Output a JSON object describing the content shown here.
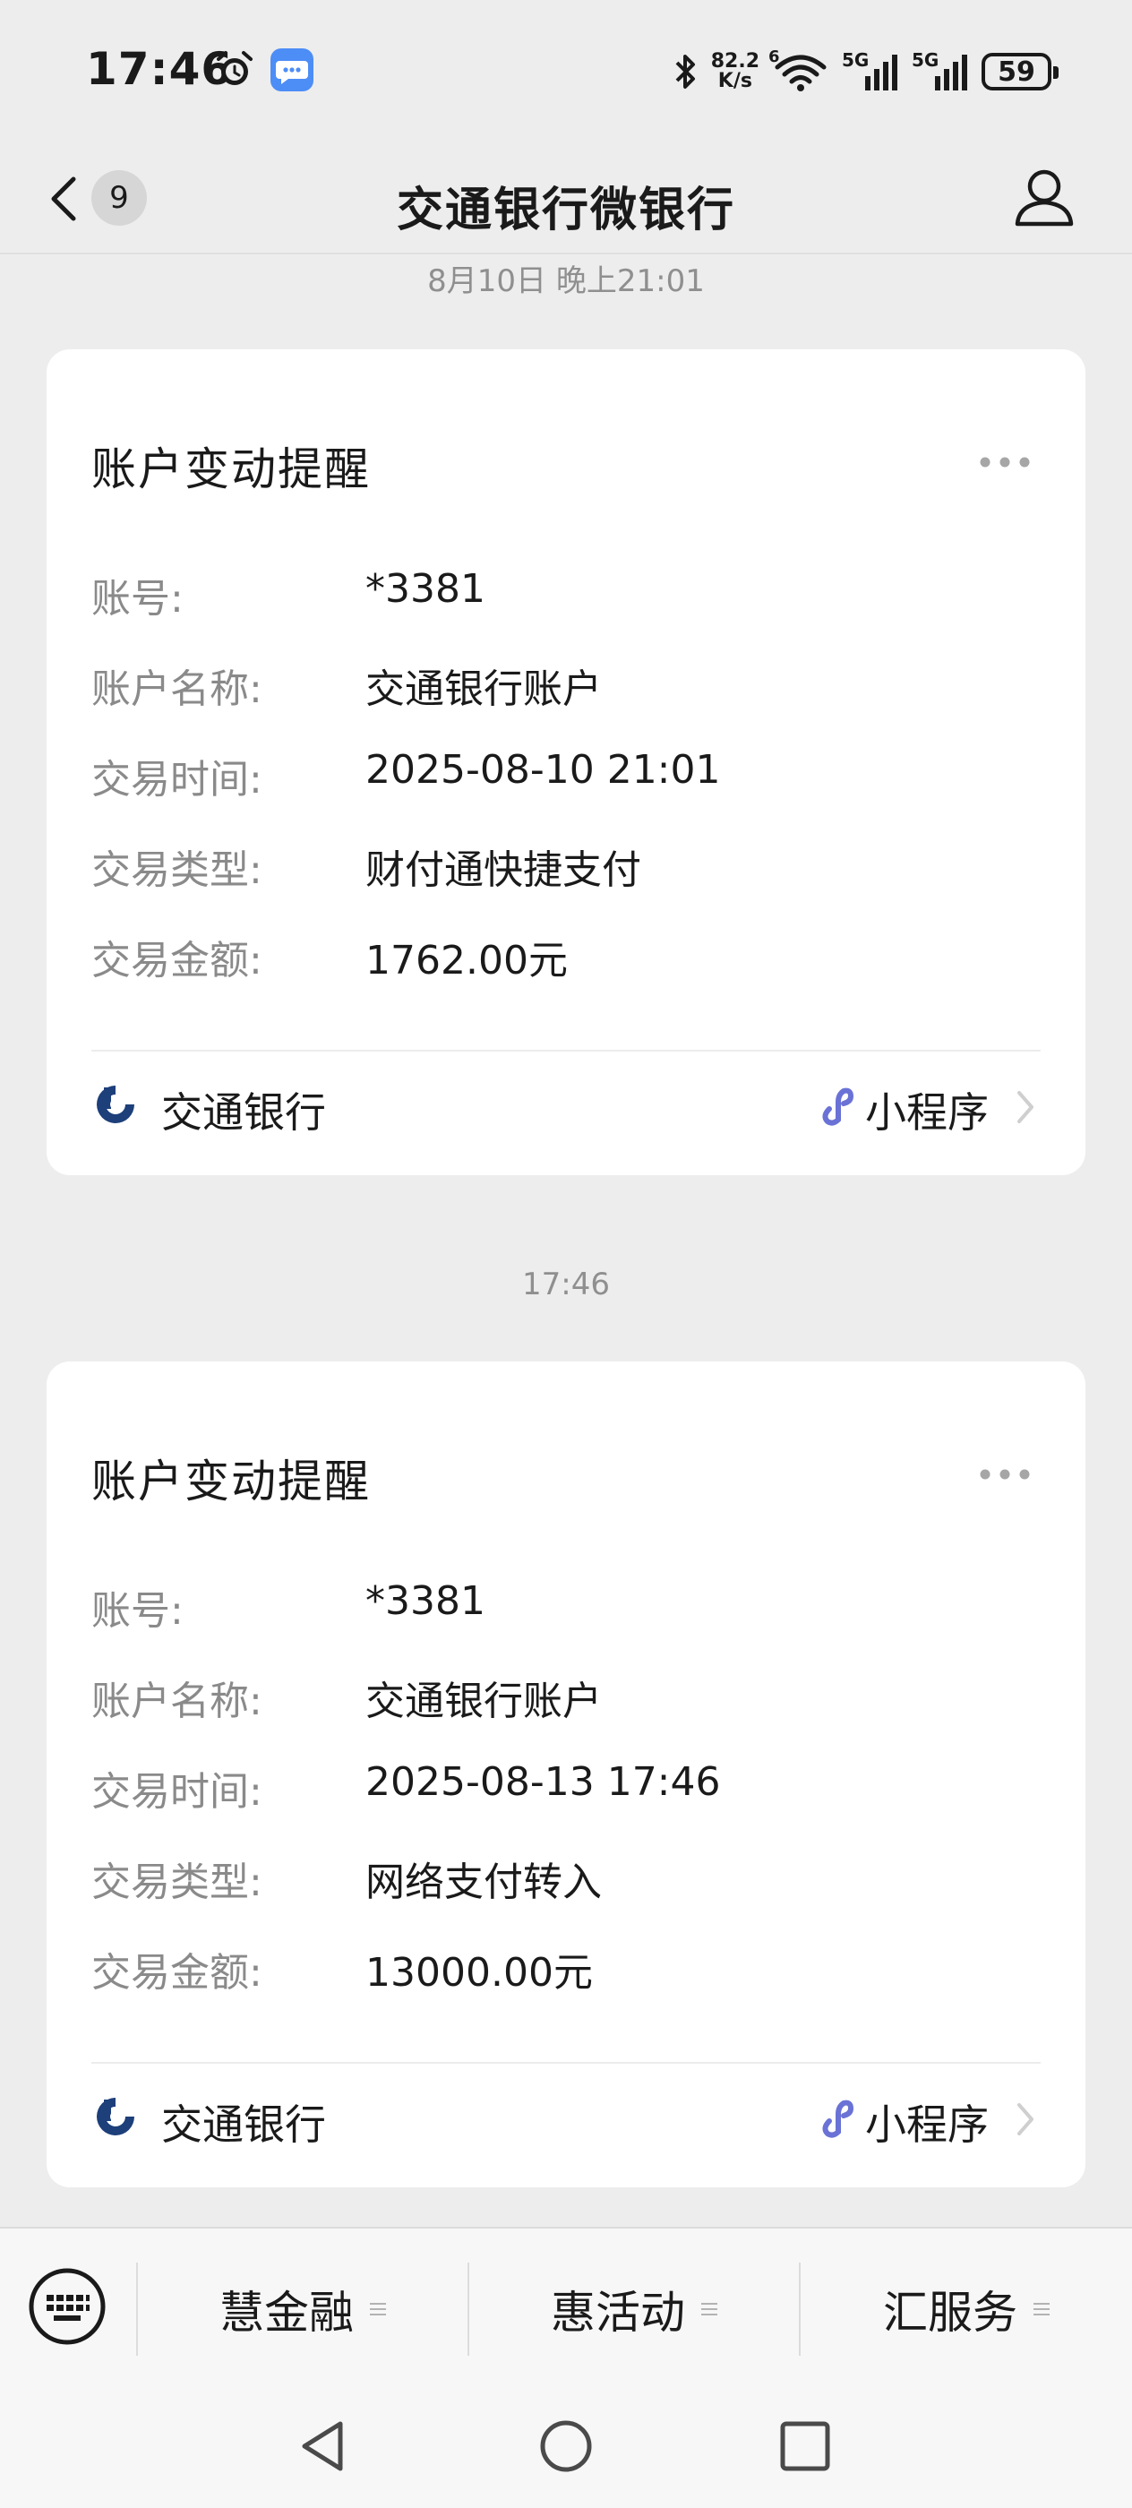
{
  "status_bar": {
    "time": "17:46",
    "net_speed_value": "82.2",
    "net_speed_unit": "K/s",
    "wifi_tag": "6",
    "signal1_tag": "5G",
    "signal2_tag": "5G",
    "battery": "59"
  },
  "nav": {
    "title": "交通银行微银行",
    "unread_count": "9"
  },
  "messages": [
    {
      "time_label": "8月10日 晚上21:01",
      "title": "账户变动提醒",
      "fields": [
        {
          "label": "账号:",
          "value": "*3381"
        },
        {
          "label": "账户名称:",
          "value": "交通银行账户"
        },
        {
          "label": "交易时间:",
          "value": "2025-08-10 21:01"
        },
        {
          "label": "交易类型:",
          "value": "财付通快捷支付"
        },
        {
          "label": "交易金额:",
          "value": "1762.00元"
        }
      ],
      "footer": {
        "bank_name": "交通银行",
        "mini_program_label": "小程序"
      }
    },
    {
      "time_label": "17:46",
      "title": "账户变动提醒",
      "fields": [
        {
          "label": "账号:",
          "value": "*3381"
        },
        {
          "label": "账户名称:",
          "value": "交通银行账户"
        },
        {
          "label": "交易时间:",
          "value": "2025-08-13 17:46"
        },
        {
          "label": "交易类型:",
          "value": "网络支付转入"
        },
        {
          "label": "交易金额:",
          "value": "13000.00元"
        }
      ],
      "footer": {
        "bank_name": "交通银行",
        "mini_program_label": "小程序"
      }
    }
  ],
  "bottom_menu": {
    "items": [
      {
        "label": "慧金融"
      },
      {
        "label": "惠活动"
      },
      {
        "label": "汇服务"
      }
    ]
  },
  "colors": {
    "background": "#ededed",
    "card": "#ffffff",
    "label_gray": "#8a8a8a",
    "bank_blue": "#1d3f7a",
    "mini_program_purple": "#6a72d6",
    "message_badge_blue": "#4d8df6"
  },
  "icons": {
    "back": "chevron-left-icon",
    "profile": "person-icon",
    "more": "more-dots-icon",
    "bank": "bocom-logo-icon",
    "mini_program": "mini-program-link-icon",
    "keyboard": "keyboard-icon",
    "system_back": "triangle-back-icon",
    "system_home": "circle-home-icon",
    "system_recent": "square-recent-icon"
  }
}
